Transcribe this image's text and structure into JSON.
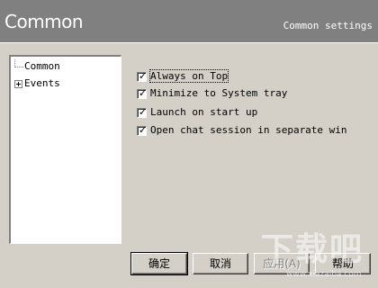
{
  "header": {
    "title": "Common",
    "subtitle": "Common settings"
  },
  "tree": {
    "items": [
      {
        "label": "Common"
      },
      {
        "label": "Events"
      }
    ]
  },
  "options": [
    {
      "label": "Always on Top",
      "checked": true
    },
    {
      "label": "Minimize to System tray",
      "checked": true
    },
    {
      "label": "Launch on start up",
      "checked": true
    },
    {
      "label": "Open chat session in separate win",
      "checked": true
    }
  ],
  "buttons": {
    "ok": "确定",
    "cancel": "取消",
    "apply": "应用(A)",
    "help": "帮助"
  },
  "watermark": {
    "big": "下载吧",
    "small": "www.xiazaiba.com"
  }
}
